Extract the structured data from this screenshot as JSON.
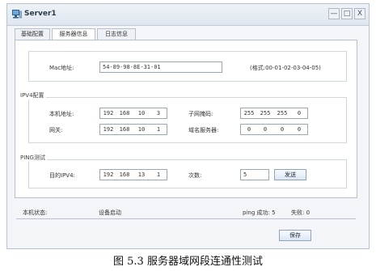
{
  "window": {
    "title": "Server1"
  },
  "window_controls": {
    "minimize": "—",
    "maximize": "□",
    "close": "X"
  },
  "tabs": [
    {
      "label": "基础配置"
    },
    {
      "label": "服务器信息"
    },
    {
      "label": "日志信息"
    }
  ],
  "mac": {
    "label": "Mac地址:",
    "value": "54-89-98-8E-31-01",
    "hint": "(格式:00-01-02-03-04-05)"
  },
  "ipv4": {
    "section": "IPV4配置",
    "ip_label": "本机地址:",
    "ip": [
      "192",
      "168",
      "10",
      "3"
    ],
    "mask_label": "子网掩码:",
    "mask": [
      "255",
      "255",
      "255",
      "0"
    ],
    "gateway_label": "网关:",
    "gateway": [
      "192",
      "168",
      "10",
      "1"
    ],
    "dns_label": "域名服务器:",
    "dns": [
      "0",
      "0",
      "0",
      "0"
    ]
  },
  "ping": {
    "section": "PING测试",
    "dest_label": "目的IPV4:",
    "dest": [
      "192",
      "168",
      "13",
      "1"
    ],
    "count_label": "次数:",
    "count": "5",
    "send_button": "发送"
  },
  "status": {
    "label": "本机状态:",
    "value": "设备启动",
    "success": "ping 成功: 5",
    "fail": "失败: 0"
  },
  "save_button": "保存",
  "caption": "图 5.3  服务器域网段连通性测试"
}
